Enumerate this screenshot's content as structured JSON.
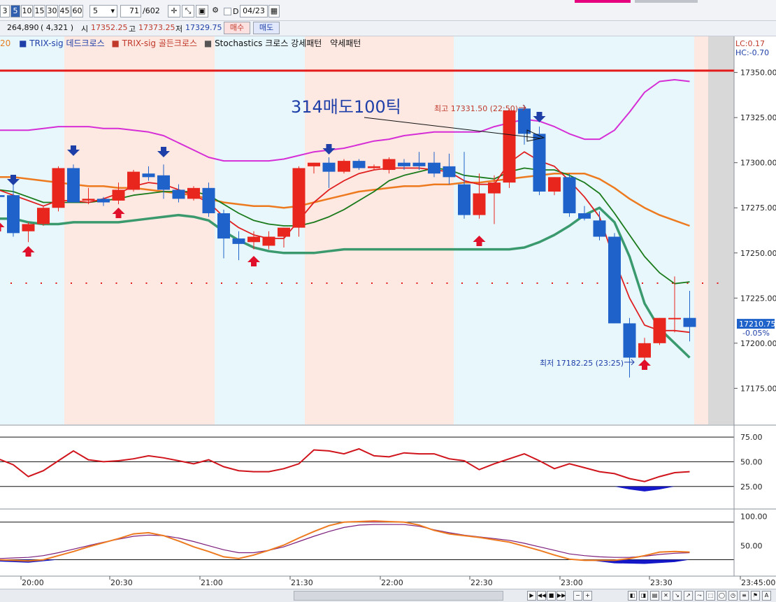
{
  "toolbar": {
    "intervals": [
      "3",
      "5",
      "10",
      "15",
      "30",
      "45",
      "60"
    ],
    "selected_interval": "5",
    "interval_select": "5",
    "count_value": "71",
    "count_total": "/602",
    "date_checkbox_label": "D",
    "date_value": "04/23"
  },
  "quote": {
    "volume": "264,890",
    "change": "( 4,321 )",
    "open_label": "시",
    "open_value": "17352.25",
    "high_label": "고",
    "high_value": "17373.25",
    "low_label": "저",
    "low_value": "17329.75",
    "buy_label": "매수",
    "sell_label": "매도"
  },
  "legend": {
    "first_fragment": "20",
    "items": [
      "TRIX-sig 데드크로스",
      "TRIX-sig 골든크로스",
      "Stochastics 크로스 강세패턴",
      "약세패턴"
    ],
    "colors": [
      "#1f3fa8",
      "#c0392b",
      "#333333",
      "#333333"
    ]
  },
  "top_right": {
    "lc": "LC:0.17",
    "hc": "HC:-0.70"
  },
  "annotations": {
    "sell_note": "314매도100틱",
    "high_note": "최고 17331.50 (22:50)",
    "low_note": "최저 17182.25 (23:25)"
  },
  "chart_data": {
    "type": "candlestick",
    "interval_minutes": 5,
    "price_axis": {
      "ticks": [
        "17350.00",
        "17325.00",
        "17300.00",
        "17275.00",
        "17250.00",
        "17225.00",
        "17200.00",
        "17175.00"
      ],
      "range": [
        17155,
        17370
      ]
    },
    "current_price": {
      "value": 17210.75,
      "label": "17210.75",
      "change_label": "-0.05%"
    },
    "resistance_line": 17351,
    "time_axis": {
      "labels": [
        "20:00",
        "20:30",
        "21:00",
        "21:30",
        "22:00",
        "22:30",
        "23:00",
        "23:30",
        "23:45:00"
      ]
    },
    "candles": [
      {
        "o": 17282,
        "h": 17286,
        "l": 17276,
        "c": 17281
      },
      {
        "o": 17282,
        "h": 17289,
        "l": 17259,
        "c": 17261
      },
      {
        "o": 17262,
        "h": 17267,
        "l": 17256,
        "c": 17266
      },
      {
        "o": 17266,
        "h": 17276,
        "l": 17265,
        "c": 17275
      },
      {
        "o": 17275,
        "h": 17298,
        "l": 17273,
        "c": 17297
      },
      {
        "o": 17297,
        "h": 17299,
        "l": 17279,
        "c": 17278
      },
      {
        "o": 17279,
        "h": 17286,
        "l": 17277,
        "c": 17280
      },
      {
        "o": 17280,
        "h": 17281,
        "l": 17276,
        "c": 17278
      },
      {
        "o": 17279,
        "h": 17289,
        "l": 17277,
        "c": 17285
      },
      {
        "o": 17285,
        "h": 17296,
        "l": 17284,
        "c": 17295
      },
      {
        "o": 17294,
        "h": 17298,
        "l": 17290,
        "c": 17292
      },
      {
        "o": 17293,
        "h": 17299,
        "l": 17280,
        "c": 17285
      },
      {
        "o": 17285,
        "h": 17288,
        "l": 17278,
        "c": 17280
      },
      {
        "o": 17280,
        "h": 17287,
        "l": 17279,
        "c": 17286
      },
      {
        "o": 17286,
        "h": 17289,
        "l": 17270,
        "c": 17272
      },
      {
        "o": 17272,
        "h": 17274,
        "l": 17247,
        "c": 17258
      },
      {
        "o": 17258,
        "h": 17262,
        "l": 17246,
        "c": 17255
      },
      {
        "o": 17256,
        "h": 17262,
        "l": 17252,
        "c": 17259
      },
      {
        "o": 17254,
        "h": 17262,
        "l": 17252,
        "c": 17259
      },
      {
        "o": 17259,
        "h": 17264,
        "l": 17253,
        "c": 17264
      },
      {
        "o": 17264,
        "h": 17298,
        "l": 17259,
        "c": 17297
      },
      {
        "o": 17298,
        "h": 17300,
        "l": 17294,
        "c": 17300
      },
      {
        "o": 17300,
        "h": 17303,
        "l": 17286,
        "c": 17295
      },
      {
        "o": 17295,
        "h": 17302,
        "l": 17294,
        "c": 17301
      },
      {
        "o": 17301,
        "h": 17302,
        "l": 17296,
        "c": 17297
      },
      {
        "o": 17297,
        "h": 17299,
        "l": 17296,
        "c": 17298
      },
      {
        "o": 17296,
        "h": 17303,
        "l": 17294,
        "c": 17302
      },
      {
        "o": 17300,
        "h": 17302,
        "l": 17296,
        "c": 17298
      },
      {
        "o": 17300,
        "h": 17306,
        "l": 17296,
        "c": 17298
      },
      {
        "o": 17300,
        "h": 17306,
        "l": 17292,
        "c": 17294
      },
      {
        "o": 17298,
        "h": 17305,
        "l": 17288,
        "c": 17292
      },
      {
        "o": 17288,
        "h": 17306,
        "l": 17269,
        "c": 17271
      },
      {
        "o": 17271,
        "h": 17294,
        "l": 17269,
        "c": 17283
      },
      {
        "o": 17283,
        "h": 17293,
        "l": 17266,
        "c": 17289
      },
      {
        "o": 17289,
        "h": 17330,
        "l": 17286,
        "c": 17329
      },
      {
        "o": 17330,
        "h": 17332,
        "l": 17310,
        "c": 17316
      },
      {
        "o": 17316,
        "h": 17320,
        "l": 17282,
        "c": 17284
      },
      {
        "o": 17284,
        "h": 17292,
        "l": 17282,
        "c": 17292
      },
      {
        "o": 17292,
        "h": 17294,
        "l": 17270,
        "c": 17272
      },
      {
        "o": 17272,
        "h": 17276,
        "l": 17268,
        "c": 17269
      },
      {
        "o": 17268,
        "h": 17273,
        "l": 17257,
        "c": 17259
      },
      {
        "o": 17259,
        "h": 17261,
        "l": 17211,
        "c": 17211
      },
      {
        "o": 17211,
        "h": 17214,
        "l": 17181,
        "c": 17192
      },
      {
        "o": 17192,
        "h": 17203,
        "l": 17190,
        "c": 17200
      },
      {
        "o": 17200,
        "h": 17214,
        "l": 17199,
        "c": 17214
      },
      {
        "o": 17214,
        "h": 17237,
        "l": 17206,
        "c": 17214
      },
      {
        "o": 17214,
        "h": 17229,
        "l": 17201,
        "c": 17209
      }
    ],
    "ma_red": [
      17285,
      17282,
      17279,
      17276,
      17279,
      17279,
      17278,
      17280,
      17283,
      17287,
      17289,
      17288,
      17285,
      17282,
      17278,
      17270,
      17264,
      17260,
      17258,
      17258,
      17268,
      17278,
      17285,
      17290,
      17294,
      17296,
      17297,
      17297,
      17297,
      17296,
      17295,
      17290,
      17288,
      17288,
      17300,
      17306,
      17301,
      17298,
      17290,
      17281,
      17270,
      17246,
      17225,
      17210,
      17207,
      17207,
      17206
    ],
    "ma_green": [
      17285,
      17284,
      17281,
      17278,
      17278,
      17278,
      17278,
      17279,
      17280,
      17282,
      17283,
      17284,
      17284,
      17284,
      17282,
      17277,
      17272,
      17268,
      17266,
      17265,
      17265,
      17267,
      17270,
      17274,
      17279,
      17284,
      17290,
      17293,
      17295,
      17297,
      17296,
      17293,
      17292,
      17291,
      17295,
      17297,
      17296,
      17296,
      17293,
      17289,
      17283,
      17272,
      17260,
      17248,
      17239,
      17233,
      17234
    ],
    "ma_orange": [
      17292,
      17292,
      17291,
      17290,
      17289,
      17288,
      17287,
      17287,
      17286,
      17286,
      17285,
      17284,
      17283,
      17282,
      17280,
      17278,
      17277,
      17276,
      17276,
      17275,
      17276,
      17278,
      17280,
      17282,
      17284,
      17285,
      17286,
      17287,
      17287,
      17288,
      17288,
      17289,
      17289,
      17290,
      17291,
      17292,
      17293,
      17294,
      17294,
      17294,
      17291,
      17286,
      17280,
      17275,
      17271,
      17268,
      17265
    ],
    "ma_thickgreen": [
      17269,
      17269,
      17267,
      17266,
      17266,
      17267,
      17267,
      17267,
      17267,
      17268,
      17269,
      17270,
      17271,
      17270,
      17268,
      17262,
      17257,
      17253,
      17251,
      17250,
      17250,
      17250,
      17251,
      17252,
      17252,
      17252,
      17252,
      17252,
      17252,
      17252,
      17252,
      17252,
      17252,
      17252,
      17252,
      17253,
      17256,
      17260,
      17265,
      17271,
      17275,
      17267,
      17248,
      17222,
      17208,
      17200,
      17192
    ],
    "bb_upper": [
      17318,
      17318,
      17318,
      17319,
      17320,
      17320,
      17320,
      17319,
      17319,
      17318,
      17317,
      17315,
      17311,
      17307,
      17303,
      17301,
      17301,
      17301,
      17301,
      17302,
      17304,
      17306,
      17307,
      17308,
      17310,
      17312,
      17313,
      17315,
      17316,
      17317,
      17317,
      17317,
      17317,
      17320,
      17322,
      17324,
      17323,
      17320,
      17316,
      17313,
      17313,
      17318,
      17328,
      17339,
      17345,
      17346,
      17345
    ],
    "osc1": [
      53,
      47,
      35,
      41,
      51,
      61,
      52,
      50,
      51,
      53,
      56,
      54,
      51,
      48,
      52,
      45,
      41,
      40,
      40,
      43,
      48,
      62,
      61,
      58,
      63,
      56,
      55,
      59,
      58,
      58,
      53,
      51,
      42,
      48,
      53,
      58,
      51,
      43,
      48,
      44,
      40,
      38,
      33,
      30,
      35,
      39,
      40
    ],
    "osc2_orange": [
      26,
      25,
      24,
      26,
      33,
      40,
      48,
      55,
      62,
      70,
      72,
      67,
      58,
      48,
      40,
      31,
      28,
      34,
      42,
      51,
      63,
      74,
      84,
      90,
      91,
      92,
      91,
      90,
      85,
      76,
      70,
      67,
      64,
      60,
      56,
      49,
      42,
      34,
      27,
      25,
      25,
      25,
      28,
      33,
      39,
      40,
      39
    ],
    "osc2_purple": [
      28,
      29,
      30,
      33,
      38,
      44,
      50,
      56,
      61,
      66,
      68,
      67,
      63,
      57,
      50,
      43,
      38,
      38,
      42,
      48,
      57,
      66,
      74,
      81,
      85,
      86,
      86,
      86,
      83,
      77,
      72,
      68,
      65,
      62,
      59,
      54,
      48,
      42,
      36,
      33,
      31,
      30,
      30,
      32,
      35,
      37,
      38
    ],
    "osc1_axis": {
      "ticks": [
        "75.00",
        "50.00",
        "25.00"
      ]
    },
    "osc2_axis": {
      "ticks": [
        "100.00",
        "50.00"
      ]
    }
  }
}
